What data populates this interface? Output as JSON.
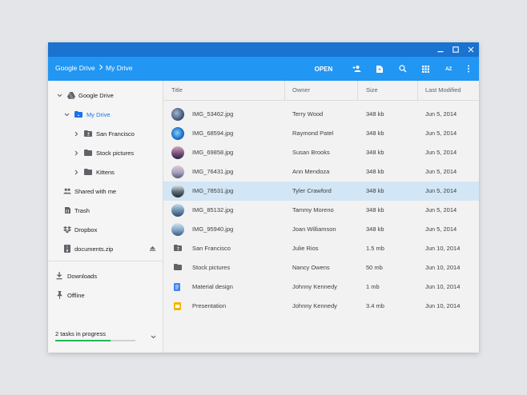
{
  "breadcrumb": {
    "root": "Google Drive",
    "current": "My Drive"
  },
  "toolbar": {
    "open_label": "OPEN",
    "sort_label": "AZ"
  },
  "sidebar": {
    "items": [
      {
        "label": "Google Drive"
      },
      {
        "label": "My Drive"
      },
      {
        "label": "San Francisco"
      },
      {
        "label": "Stock pictures"
      },
      {
        "label": "Kittens"
      },
      {
        "label": "Shared with me"
      },
      {
        "label": "Trash"
      },
      {
        "label": "Dropbox"
      },
      {
        "label": "documents.zip"
      },
      {
        "label": "Downloads"
      },
      {
        "label": "Offline"
      }
    ],
    "tasks_label": "2 tasks in progress",
    "tasks_progress": 0.69
  },
  "table": {
    "headers": {
      "title": "Title",
      "owner": "Owner",
      "size": "Size",
      "modified": "Last Modified"
    },
    "rows": [
      {
        "title": "IMG_53462.jpg",
        "owner": "Terry Wood",
        "size": "348 kb",
        "modified": "Jun 5, 2014",
        "icon": "image-thumbnail"
      },
      {
        "title": "IMG_68594.jpg",
        "owner": "Raymond Patel",
        "size": "348 kb",
        "modified": "Jun 5, 2014",
        "icon": "image-thumbnail"
      },
      {
        "title": "IMG_69858.jpg",
        "owner": "Susan Brooks",
        "size": "348 kb",
        "modified": "Jun 5, 2014",
        "icon": "image-thumbnail"
      },
      {
        "title": "IMG_76431.jpg",
        "owner": "Ann Mendoza",
        "size": "348 kb",
        "modified": "Jun 5, 2014",
        "icon": "image-thumbnail"
      },
      {
        "title": "IMG_78531.jpg",
        "owner": "Tyler Crawford",
        "size": "348 kb",
        "modified": "Jun 5, 2014",
        "icon": "image-thumbnail",
        "selected": true
      },
      {
        "title": "IMG_85132.jpg",
        "owner": "Tammy Moreno",
        "size": "348 kb",
        "modified": "Jun 5, 2014",
        "icon": "image-thumbnail"
      },
      {
        "title": "IMG_95940.jpg",
        "owner": "Joan Williamson",
        "size": "348 kb",
        "modified": "Jun 5, 2014",
        "icon": "image-thumbnail"
      },
      {
        "title": "San Francisco",
        "owner": "Julie Rios",
        "size": "1.5 mb",
        "modified": "Jun 10, 2014",
        "icon": "shared-folder-icon"
      },
      {
        "title": "Stock pictures",
        "owner": "Nancy Owens",
        "size": "50 mb",
        "modified": "Jun 10, 2014",
        "icon": "folder-icon"
      },
      {
        "title": "Material design",
        "owner": "Johnny Kennedy",
        "size": "1 mb",
        "modified": "Jun 10, 2014",
        "icon": "docs-icon"
      },
      {
        "title": "Presentation",
        "owner": "Johnny Kennedy",
        "size": "3.4 mb",
        "modified": "Jun 10, 2014",
        "icon": "slides-icon"
      }
    ]
  },
  "colors": {
    "titlebar": "#1a73d0",
    "toolbar": "#2196f3",
    "accent": "#1a73e8",
    "selection": "#d2e6f5",
    "progress": "#1db954",
    "docs": "#4285f4",
    "slides": "#f4b400"
  }
}
